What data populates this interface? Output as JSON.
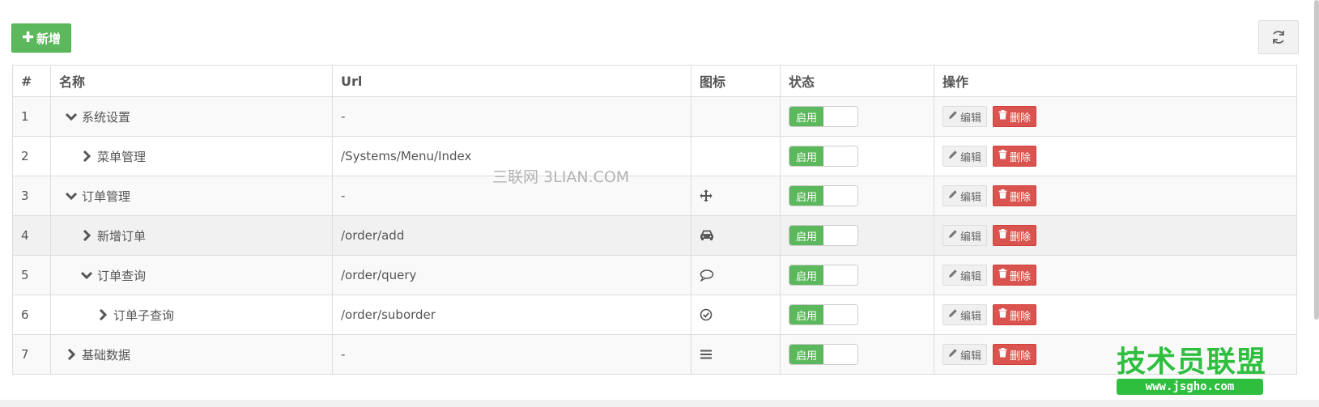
{
  "toolbar": {
    "add_label": "新增",
    "add_icon": "plus-icon",
    "refresh_icon": "refresh-icon"
  },
  "table": {
    "headers": [
      "#",
      "名称",
      "Url",
      "图标",
      "状态",
      "操作"
    ],
    "rows": [
      {
        "num": "1",
        "name": "系统设置",
        "expand": "chevron-down-icon",
        "level": 1,
        "url": "-",
        "icon": "",
        "status": "启用"
      },
      {
        "num": "2",
        "name": "菜单管理",
        "expand": "chevron-right-icon",
        "level": 2,
        "url": "/Systems/Menu/Index",
        "icon": "",
        "status": "启用"
      },
      {
        "num": "3",
        "name": "订单管理",
        "expand": "chevron-down-icon",
        "level": 1,
        "url": "-",
        "icon": "move-icon",
        "status": "启用"
      },
      {
        "num": "4",
        "name": "新增订单",
        "expand": "chevron-right-icon",
        "level": 2,
        "url": "/order/add",
        "icon": "car-icon",
        "status": "启用"
      },
      {
        "num": "5",
        "name": "订单查询",
        "expand": "chevron-down-icon",
        "level": 2,
        "url": "/order/query",
        "icon": "comment-icon",
        "status": "启用"
      },
      {
        "num": "6",
        "name": "订单子查询",
        "expand": "chevron-right-icon",
        "level": 3,
        "url": "/order/suborder",
        "icon": "check-circle-icon",
        "status": "启用"
      },
      {
        "num": "7",
        "name": "基础数据",
        "expand": "chevron-right-icon",
        "level": 1,
        "url": "-",
        "icon": "bars-icon",
        "status": "启用"
      }
    ],
    "edit_label": "编辑",
    "delete_label": "删除"
  },
  "watermark": "三联网 3LIAN.COM",
  "logo": {
    "title": "技术员联盟",
    "url": "www.jsgho.com"
  },
  "colors": {
    "success": "#5cb85c",
    "danger": "#d9534f",
    "logo_green": "#2fbf3f"
  }
}
